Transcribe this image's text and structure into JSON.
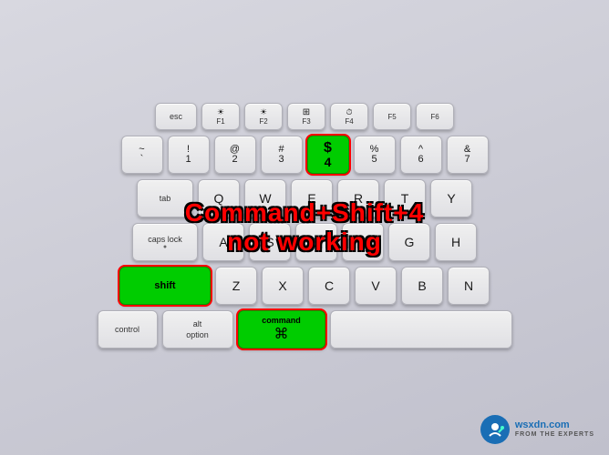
{
  "keyboard": {
    "title": "Command+Shift+4 not working",
    "overlay": {
      "line1": "Command+Shift+4",
      "line2": "not working"
    },
    "rows": {
      "fn_row": [
        "esc",
        "F1",
        "F2",
        "F3",
        "F4",
        "F5",
        "F6"
      ],
      "num_row": [
        {
          "top": "~",
          "bot": "`"
        },
        {
          "top": "!",
          "bot": "1"
        },
        {
          "top": "@",
          "bot": "2"
        },
        {
          "top": "#",
          "bot": "3"
        },
        {
          "top": "$",
          "bot": "4",
          "highlight": true
        },
        {
          "top": "%",
          "bot": "5"
        },
        {
          "top": "^",
          "bot": "6"
        },
        {
          "top": "&",
          "bot": "7"
        }
      ]
    },
    "watermark": {
      "site": "wsxdn.com",
      "tagline": "FROM THE EXPERTS"
    }
  }
}
